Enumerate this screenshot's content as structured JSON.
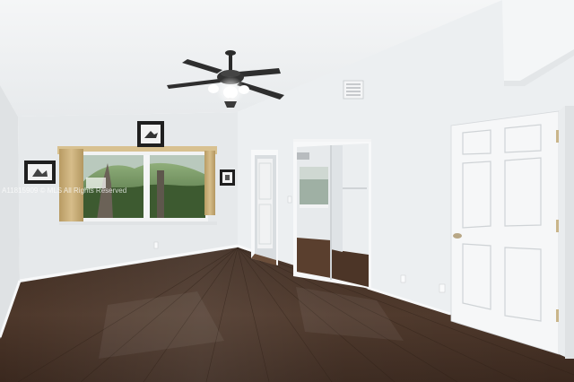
{
  "photo": {
    "watermark": "A11815909 © MLS All Rights Reserved",
    "palette": {
      "ceiling": "#f1f3f4",
      "wall_left": "#e4e7e9",
      "wall_back": "#e9ecee",
      "wall_right": "#edf0f2",
      "floor": "#4a3427",
      "door": "#f6f7f8",
      "curtain": "#c9b07e",
      "fan_body": "#2b2b2b"
    }
  }
}
